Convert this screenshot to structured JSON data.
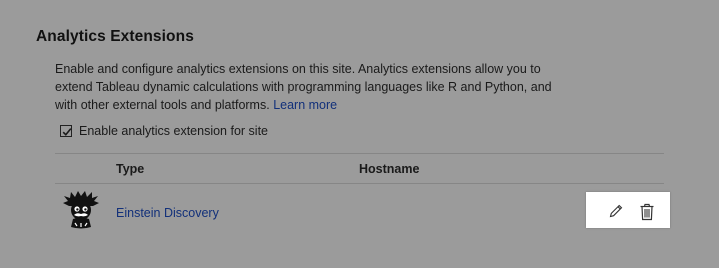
{
  "section": {
    "title": "Analytics Extensions",
    "description": "Enable and configure analytics extensions on this site. Analytics extensions allow you to extend Tableau dynamic calculations with programming languages like R and Python, and with other external tools and platforms.",
    "learn_more": "Learn more"
  },
  "enable_checkbox": {
    "label": "Enable analytics extension for site",
    "checked": true
  },
  "table": {
    "columns": [
      "Type",
      "Hostname"
    ],
    "rows": [
      {
        "type": "Einstein Discovery",
        "hostname": "",
        "icon": "einstein-avatar-icon"
      }
    ]
  },
  "actions": {
    "edit_icon": "pencil-icon",
    "delete_icon": "trash-icon"
  },
  "colors": {
    "overlay_background": "#9b9b9b",
    "link": "#12307a",
    "action_panel": "#ffffff"
  }
}
